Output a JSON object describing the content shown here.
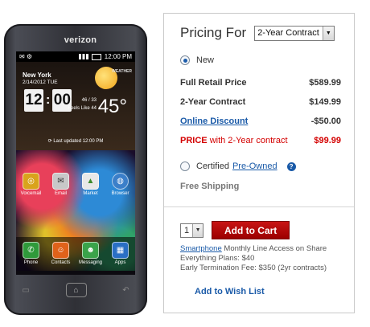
{
  "phone": {
    "brand": "verizon",
    "status_time": "12:00 PM",
    "weather": {
      "city": "New York",
      "date": "2/14/2012 TUE",
      "provider": "WEATHER",
      "clock_hour": "12",
      "clock_minute": "00",
      "temperature": "45°",
      "hi_lo": "46 / 33",
      "feels_like": "Feels Like 44",
      "updated": "Last updated 12:00 PM"
    },
    "apps_row1": [
      {
        "label": "Voicemail",
        "icon": "voicemail-icon"
      },
      {
        "label": "Email",
        "icon": "email-icon"
      },
      {
        "label": "Market",
        "icon": "market-icon"
      },
      {
        "label": "Browser",
        "icon": "globe-icon"
      }
    ],
    "apps_dock": [
      {
        "label": "Phone",
        "icon": "phone-icon",
        "color": "#2f9a3a"
      },
      {
        "label": "Contacts",
        "icon": "contacts-icon",
        "color": "#e0621a"
      },
      {
        "label": "Messaging",
        "icon": "messaging-icon",
        "color": "#3aa34a"
      },
      {
        "label": "Apps",
        "icon": "apps-grid-icon",
        "color": "#2a6fc4"
      }
    ]
  },
  "pricing": {
    "title": "Pricing For",
    "contract_select": "2-Year Contract",
    "new_label": "New",
    "rows": {
      "retail": {
        "label": "Full Retail Price",
        "value": "$589.99"
      },
      "contract": {
        "label": "2-Year Contract",
        "value": "$149.99"
      },
      "discount": {
        "label": "Online Discount",
        "value": "-$50.00"
      },
      "price_label": "PRICE",
      "price_suffix": "with 2-Year contract",
      "price_value": "$99.99"
    },
    "certified_label": "Certified",
    "preowned_link": "Pre-Owned",
    "shipping": "Free Shipping",
    "quantity": "1",
    "add_to_cart": "Add to Cart",
    "fine_link": "Smartphone",
    "fine_text": "Monthly Line Access on Share Everything Plans: $40",
    "termination": "Early Termination Fee: $350 (2yr contracts)",
    "wishlist": "Add to Wish List"
  }
}
